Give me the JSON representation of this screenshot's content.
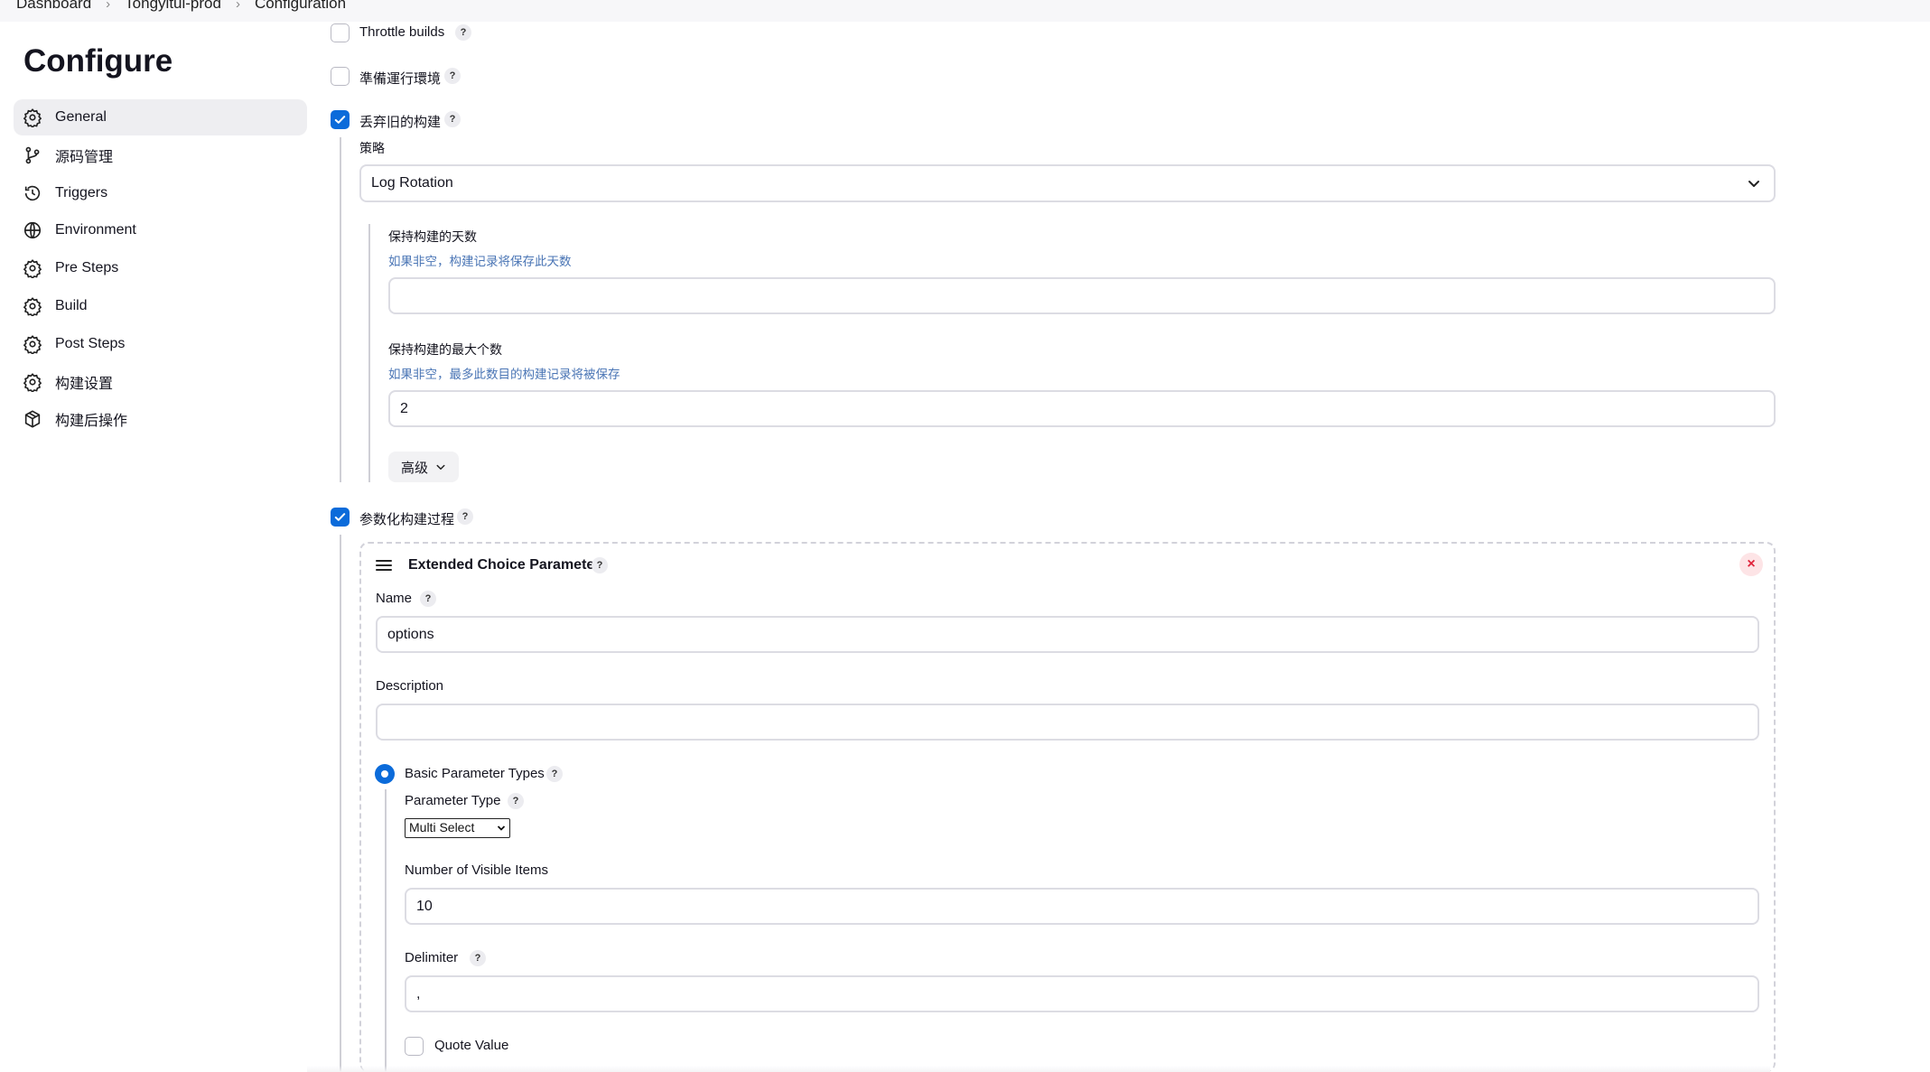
{
  "breadcrumb": {
    "items": [
      "Dashboard",
      "Tongyitui-prod",
      "Configuration"
    ]
  },
  "page": {
    "title": "Configure"
  },
  "sidebar": {
    "items": [
      {
        "label": "General",
        "icon": "gear-icon",
        "active": true
      },
      {
        "label": "源码管理",
        "icon": "branch-icon"
      },
      {
        "label": "Triggers",
        "icon": "clock-icon"
      },
      {
        "label": "Environment",
        "icon": "globe-icon"
      },
      {
        "label": "Pre Steps",
        "icon": "gear-icon"
      },
      {
        "label": "Build",
        "icon": "gear-icon"
      },
      {
        "label": "Post Steps",
        "icon": "gear-icon"
      },
      {
        "label": "构建设置",
        "icon": "gear-icon"
      },
      {
        "label": "构建后操作",
        "icon": "package-icon"
      }
    ]
  },
  "options": {
    "throttle": {
      "label": "Throttle builds",
      "checked": false,
      "help": "?"
    },
    "prepare_env": {
      "label": "準備運行環境",
      "checked": false,
      "help": "?"
    },
    "discard_old": {
      "label": "丢弃旧的构建",
      "checked": true,
      "help": "?"
    },
    "parameterized": {
      "label": "参数化构建过程",
      "checked": true,
      "help": "?"
    }
  },
  "discard": {
    "strategy_label": "策略",
    "strategy_value": "Log Rotation",
    "days_label": "保持构建的天数",
    "days_desc": "如果非空，构建记录将保存此天数",
    "days_value": "",
    "max_label": "保持构建的最大个数",
    "max_desc": "如果非空，最多此数目的构建记录将被保存",
    "max_value": "2",
    "advanced_label": "高级"
  },
  "ecp": {
    "title": "Extended Choice Parameter",
    "help": "?",
    "close": "×",
    "name_label": "Name",
    "name_value": "options",
    "description_label": "Description",
    "description_value": "",
    "basic_types_label": "Basic Parameter Types",
    "param_type_label": "Parameter Type",
    "param_type_value": "Multi Select",
    "visible_items_label": "Number of Visible Items",
    "visible_items_value": "10",
    "delimiter_label": "Delimiter",
    "delimiter_value": ",",
    "quote_value_label": "Quote Value"
  },
  "colors": {
    "accent": "#0b6bda",
    "sidebar_active_bg": "#eeeef1",
    "description_text": "#4a75b5",
    "close_red": "#e0243b"
  }
}
